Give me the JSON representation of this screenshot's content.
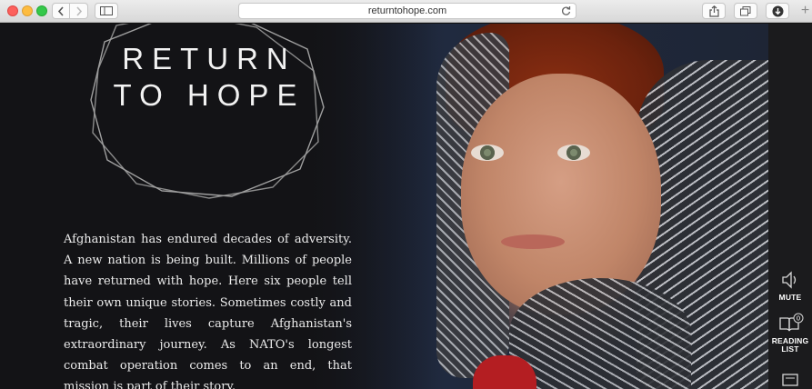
{
  "browser": {
    "url": "returntohope.com",
    "window_controls": [
      "close",
      "minimize",
      "maximize"
    ],
    "toolbar_icons": [
      "back-arrow-icon",
      "forward-arrow-icon",
      "sidebar-icon",
      "reload-icon",
      "share-icon",
      "tabs-icon",
      "download-icon"
    ],
    "new_tab": "+"
  },
  "hero": {
    "logo_line_1": "RETURN",
    "logo_line_2": "TO HOPE",
    "intro_text": "Afghanistan has endured decades of adversity. A new nation is being built. Millions of people have returned with hope. Here six people tell their own unique stories. Sometimes costly and tragic, their lives capture Afghanistan's extraordinary journey. As NATO's longest combat operation comes to an end, that mission is part of their story."
  },
  "rail": {
    "mute_label": "MUTE",
    "reading_list_label_1": "READING",
    "reading_list_label_2": "LIST",
    "reading_list_count": "0"
  },
  "colors": {
    "page_bg": "#131316",
    "rail_bg": "#1b1b1d",
    "text": "#ececec",
    "hair": "#7a2812"
  }
}
